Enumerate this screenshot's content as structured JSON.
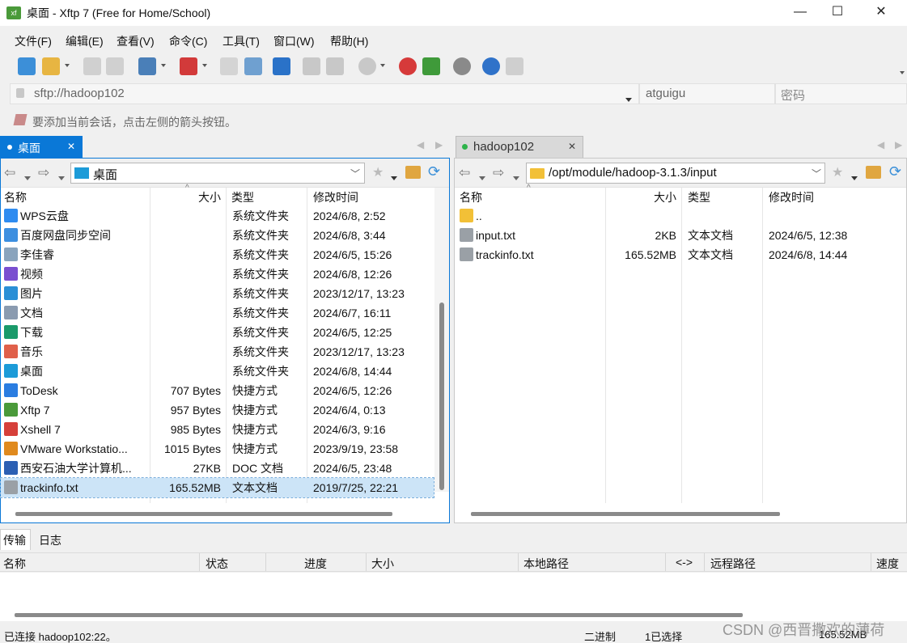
{
  "window": {
    "title": "桌面 - Xftp 7 (Free for Home/School)",
    "app_icon_text": "xf",
    "minimize": "—",
    "maximize": "☐",
    "close": "✕"
  },
  "menu": [
    "文件(F)",
    "编辑(E)",
    "查看(V)",
    "命令(C)",
    "工具(T)",
    "窗口(W)",
    "帮助(H)"
  ],
  "address": {
    "value": "sftp://hadoop102",
    "user": "atguigu",
    "password_placeholder": "密码"
  },
  "hint": "要添加当前会话，点击左侧的箭头按钮。",
  "left_pane": {
    "tab_label": "桌面",
    "path": "桌面",
    "columns": [
      "名称",
      "大小",
      "类型",
      "修改时间"
    ],
    "rows": [
      {
        "name": "WPS云盘",
        "size": "",
        "type": "系统文件夹",
        "modified": "2024/6/8, 2:52",
        "icon": "cloud-icon",
        "color": "#2f8cf0"
      },
      {
        "name": "百度网盘同步空间",
        "size": "",
        "type": "系统文件夹",
        "modified": "2024/6/8, 3:44",
        "icon": "baidu-sync-icon",
        "color": "#3d8fe0"
      },
      {
        "name": "李佳睿",
        "size": "",
        "type": "系统文件夹",
        "modified": "2024/6/5, 15:26",
        "icon": "user-folder-icon",
        "color": "#8aa4bd"
      },
      {
        "name": "视频",
        "size": "",
        "type": "系统文件夹",
        "modified": "2024/6/8, 12:26",
        "icon": "video-icon",
        "color": "#7a4fd0"
      },
      {
        "name": "图片",
        "size": "",
        "type": "系统文件夹",
        "modified": "2023/12/17, 13:23",
        "icon": "pictures-icon",
        "color": "#2a8fd6"
      },
      {
        "name": "文档",
        "size": "",
        "type": "系统文件夹",
        "modified": "2024/6/7, 16:11",
        "icon": "documents-icon",
        "color": "#8a9bb0"
      },
      {
        "name": "下载",
        "size": "",
        "type": "系统文件夹",
        "modified": "2024/6/5, 12:25",
        "icon": "download-icon",
        "color": "#1a9a6a"
      },
      {
        "name": "音乐",
        "size": "",
        "type": "系统文件夹",
        "modified": "2023/12/17, 13:23",
        "icon": "music-icon",
        "color": "#e0604a"
      },
      {
        "name": "桌面",
        "size": "",
        "type": "系统文件夹",
        "modified": "2024/6/8, 14:44",
        "icon": "desktop-icon",
        "color": "#1c9bd8"
      },
      {
        "name": "ToDesk",
        "size": "707 Bytes",
        "type": "快捷方式",
        "modified": "2024/6/5, 12:26",
        "icon": "todesk-shortcut-icon",
        "color": "#2a7de1"
      },
      {
        "name": "Xftp 7",
        "size": "957 Bytes",
        "type": "快捷方式",
        "modified": "2024/6/4, 0:13",
        "icon": "xftp-shortcut-icon",
        "color": "#4a9a3a"
      },
      {
        "name": "Xshell 7",
        "size": "985 Bytes",
        "type": "快捷方式",
        "modified": "2024/6/3, 9:16",
        "icon": "xshell-shortcut-icon",
        "color": "#d6403a"
      },
      {
        "name": "VMware Workstatio...",
        "size": "1015 Bytes",
        "type": "快捷方式",
        "modified": "2023/9/19, 23:58",
        "icon": "vmware-shortcut-icon",
        "color": "#e08a1e"
      },
      {
        "name": "西安石油大学计算机...",
        "size": "27KB",
        "type": "DOC 文档",
        "modified": "2024/6/5, 23:48",
        "icon": "word-doc-icon",
        "color": "#2b5fb3"
      },
      {
        "name": "trackinfo.txt",
        "size": "165.52MB",
        "type": "文本文档",
        "modified": "2019/7/25, 22:21",
        "icon": "text-file-icon",
        "color": "#9aa0a6",
        "selected": true
      }
    ]
  },
  "right_pane": {
    "tab_label": "hadoop102",
    "path": "/opt/module/hadoop-3.1.3/input",
    "columns": [
      "名称",
      "大小",
      "类型",
      "修改时间"
    ],
    "rows": [
      {
        "name": "..",
        "size": "",
        "type": "",
        "modified": "",
        "icon": "parent-folder-icon",
        "color": "#f2c037"
      },
      {
        "name": "input.txt",
        "size": "2KB",
        "type": "文本文档",
        "modified": "2024/6/5, 12:38",
        "icon": "text-file-icon",
        "color": "#9aa0a6"
      },
      {
        "name": "trackinfo.txt",
        "size": "165.52MB",
        "type": "文本文档",
        "modified": "2024/6/8, 14:44",
        "icon": "text-file-icon",
        "color": "#9aa0a6"
      }
    ]
  },
  "bottom": {
    "tabs": [
      "传输",
      "日志"
    ],
    "columns": [
      "名称",
      "状态",
      "进度",
      "大小",
      "本地路径",
      "<->",
      "远程路径",
      "速度"
    ]
  },
  "status": {
    "connection": "已连接 hadoop102:22。",
    "mode": "二进制",
    "selection": "1已选择",
    "size": "165.52MB",
    "watermark": "CSDN @西晋撒欢的薄荷"
  },
  "colors": {
    "accent": "#0a78d7",
    "selection": "#cce4f7",
    "connected_dot": "#2db34a"
  }
}
